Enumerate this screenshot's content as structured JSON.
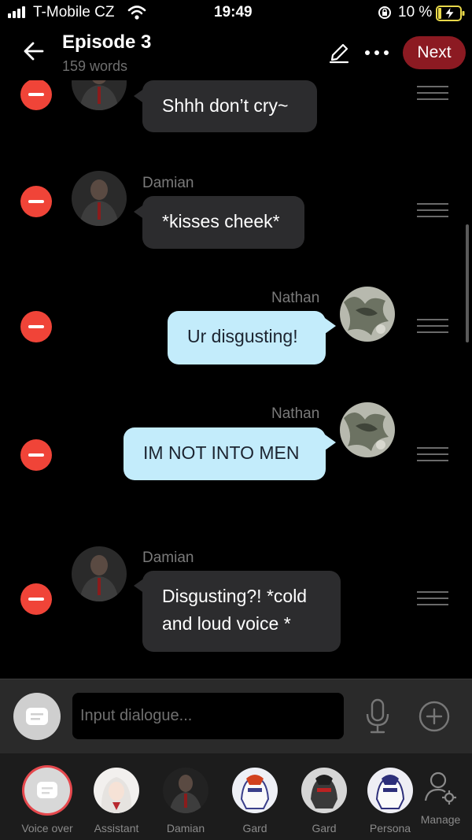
{
  "status_bar": {
    "carrier": "T-Mobile CZ",
    "time": "19:49",
    "battery": "10 %"
  },
  "header": {
    "title": "Episode 3",
    "word_count": "159 words",
    "next_label": "Next"
  },
  "messages": [
    {
      "speaker": "",
      "text": "Shhh don’t cry~",
      "side": "left"
    },
    {
      "speaker": "Damian",
      "text": "*kisses cheek*",
      "side": "left"
    },
    {
      "speaker": "Nathan",
      "text": "Ur disgusting!",
      "side": "right"
    },
    {
      "speaker": "Nathan",
      "text": "IM NOT INTO MEN",
      "side": "right"
    },
    {
      "speaker": "Damian",
      "text": "Disgusting?! *cold and loud voice *",
      "side": "left"
    }
  ],
  "composer": {
    "placeholder": "Input dialogue..."
  },
  "characters": [
    {
      "label": "Voice over"
    },
    {
      "label": "Assistant"
    },
    {
      "label": "Damian"
    },
    {
      "label": "Gard"
    },
    {
      "label": "Gard"
    },
    {
      "label": "Persona"
    },
    {
      "label": "Manage"
    }
  ],
  "colors": {
    "accent_next": "#8c1a22",
    "delete": "#f04438",
    "bubble_left": "#2c2c2e",
    "bubble_right": "#c3ecfb"
  }
}
